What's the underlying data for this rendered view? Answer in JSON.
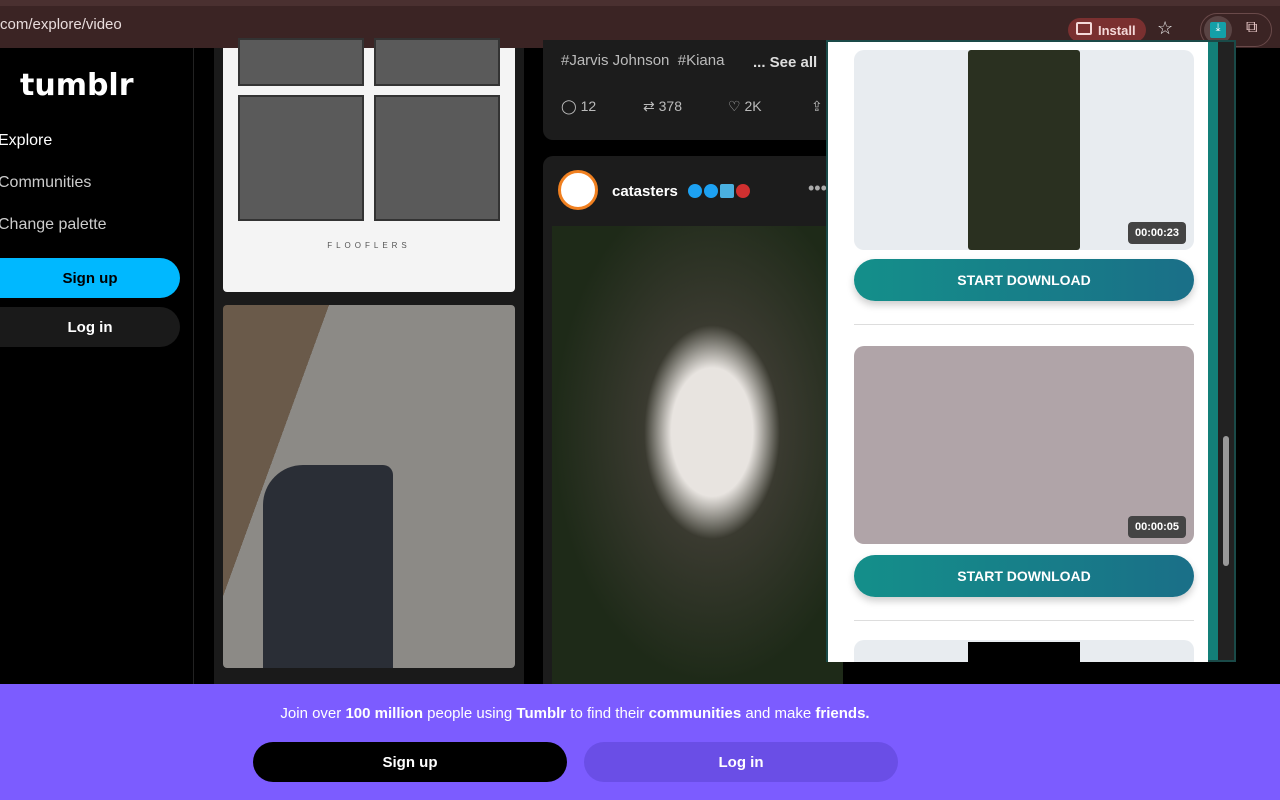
{
  "browser": {
    "url": "com/explore/video",
    "install_label": "Install"
  },
  "sidebar": {
    "logo": "tumblr",
    "nav": [
      "Explore",
      "Communities",
      "Change palette"
    ],
    "signup": "Sign up",
    "login": "Log in"
  },
  "feed": {
    "comic_watermark": "FLOOFLERS",
    "prev_post": {
      "tags": [
        "#Jarvis Johnson",
        "#Kiana"
      ],
      "see_all": "... See all",
      "comments": "12",
      "reblogs": "378",
      "likes": "2K"
    },
    "post": {
      "username": "catasters"
    }
  },
  "downloader": {
    "items": [
      {
        "duration": "00:00:23",
        "button": "START DOWNLOAD"
      },
      {
        "duration": "00:00:05",
        "button": "START DOWNLOAD"
      }
    ]
  },
  "banner": {
    "text_parts": [
      "Join over ",
      "100 million",
      " people using ",
      "Tumblr",
      " to find their ",
      "communities",
      " and make ",
      "friends."
    ],
    "signup": "Sign up",
    "login": "Log in"
  }
}
